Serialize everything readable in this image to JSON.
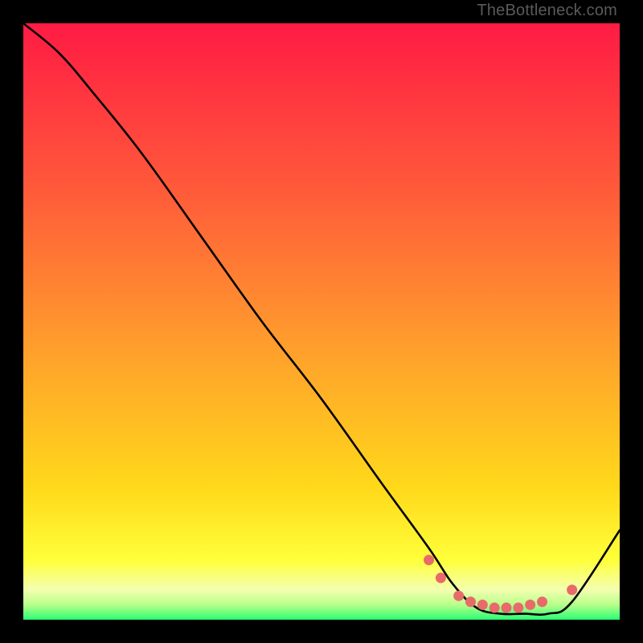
{
  "watermark": "TheBottleneck.com",
  "colors": {
    "gradient": {
      "c0": "#ff1b44",
      "c1": "#ff5a3a",
      "c2": "#ffa02c",
      "c3": "#ffd91a",
      "c4": "#ffff3a",
      "c5": "#f3ffb0",
      "c6": "#b8ff8a",
      "c7": "#2aff74"
    },
    "curve": "#000000",
    "marker": "#e86a6a"
  },
  "chart_data": {
    "type": "line",
    "title": "",
    "xlabel": "",
    "ylabel": "",
    "xlim": [
      0,
      100
    ],
    "ylim": [
      0,
      100
    ],
    "note": "Axes are unlabeled in the image; data points are normalized 0–100. y is the height of the black curve above the bottom of the plot area (0 = bottom, 100 = top).",
    "x": [
      0,
      6,
      12,
      20,
      30,
      40,
      50,
      60,
      68,
      72,
      76,
      80,
      84,
      88,
      92,
      100
    ],
    "y": [
      100,
      95,
      88,
      78,
      64,
      50,
      37,
      23,
      12,
      6,
      2,
      1,
      1,
      1,
      3,
      15
    ],
    "markers": {
      "comment": "pink dotted cluster near the trough",
      "x": [
        68,
        70,
        73,
        75,
        77,
        79,
        81,
        83,
        85,
        87,
        92
      ],
      "y": [
        10,
        7,
        4,
        3,
        2.5,
        2,
        2,
        2,
        2.5,
        3,
        5
      ]
    }
  }
}
